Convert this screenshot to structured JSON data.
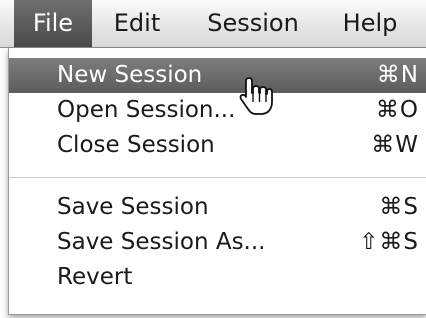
{
  "menubar": {
    "items": [
      {
        "label": "File",
        "active": true
      },
      {
        "label": "Edit",
        "active": false
      },
      {
        "label": "Session",
        "active": false
      },
      {
        "label": "Help",
        "active": false
      }
    ]
  },
  "file_menu": {
    "items": [
      {
        "label": "New Session",
        "shortcut": "⌘N",
        "highlighted": true
      },
      {
        "label": "Open Session...",
        "shortcut": "⌘O",
        "highlighted": false
      },
      {
        "label": "Close Session",
        "shortcut": "⌘W",
        "highlighted": false
      },
      {
        "label": "Save Session",
        "shortcut": "⌘S",
        "highlighted": false
      },
      {
        "label": "Save Session As...",
        "shortcut": "⇧⌘S",
        "highlighted": false
      },
      {
        "label": "Revert",
        "shortcut": "",
        "highlighted": false
      }
    ]
  },
  "cursor": {
    "icon": "hand-pointer-icon"
  },
  "colors": {
    "highlight": "#6b6b6b",
    "menubar_bg": "#e6e6e6",
    "text": "#1a1a1a"
  }
}
